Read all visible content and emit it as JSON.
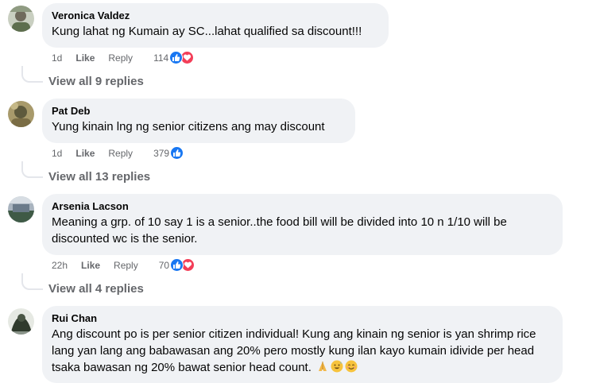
{
  "comments": [
    {
      "author": "Veronica Valdez",
      "text": "Kung lahat ng Kumain ay SC...lahat qualified sa discount!!!",
      "time": "1d",
      "like_label": "Like",
      "reply_label": "Reply",
      "reaction_count": "114",
      "reactions": [
        "like-icon",
        "love-icon"
      ],
      "view_replies": "View all 9 replies",
      "avatar_color": "#7a8a6a"
    },
    {
      "author": "Pat Deb",
      "text": "Yung kinain lng ng senior citizens ang may discount",
      "time": "1d",
      "like_label": "Like",
      "reply_label": "Reply",
      "reaction_count": "379",
      "reactions": [
        "like-icon"
      ],
      "view_replies": "View all 13 replies",
      "avatar_color": "#8c7b4e"
    },
    {
      "author": "Arsenia Lacson",
      "text": "Meaning a grp. of 10 say 1 is a senior..the food bill will be divided into 10 n 1/10 will be discounted wc is the senior.",
      "time": "22h",
      "like_label": "Like",
      "reply_label": "Reply",
      "reaction_count": "70",
      "reactions": [
        "like-icon",
        "love-icon"
      ],
      "view_replies": "View all 4 replies",
      "avatar_color": "#4f5d6b"
    },
    {
      "author": "Rui Chan",
      "text": "Ang discount po is per senior citizen individual! Kung ang kinain ng senior is yan shrimp rice lang yan lang ang babawasan ang 20% pero mostly kung ilan kayo kumain idivide per head tsaka bawasan ng 20% bawat senior head count.",
      "trailing_emojis": [
        "folded-hands-emoji",
        "grinning-sweat-emoji",
        "smiling-emoji"
      ],
      "avatar_color": "#3d4a3a"
    }
  ],
  "colors": {
    "bubble_bg": "#f0f2f5",
    "meta_text": "#65676b",
    "like_blue": "#1877f2",
    "love_red": "#f33e58"
  }
}
